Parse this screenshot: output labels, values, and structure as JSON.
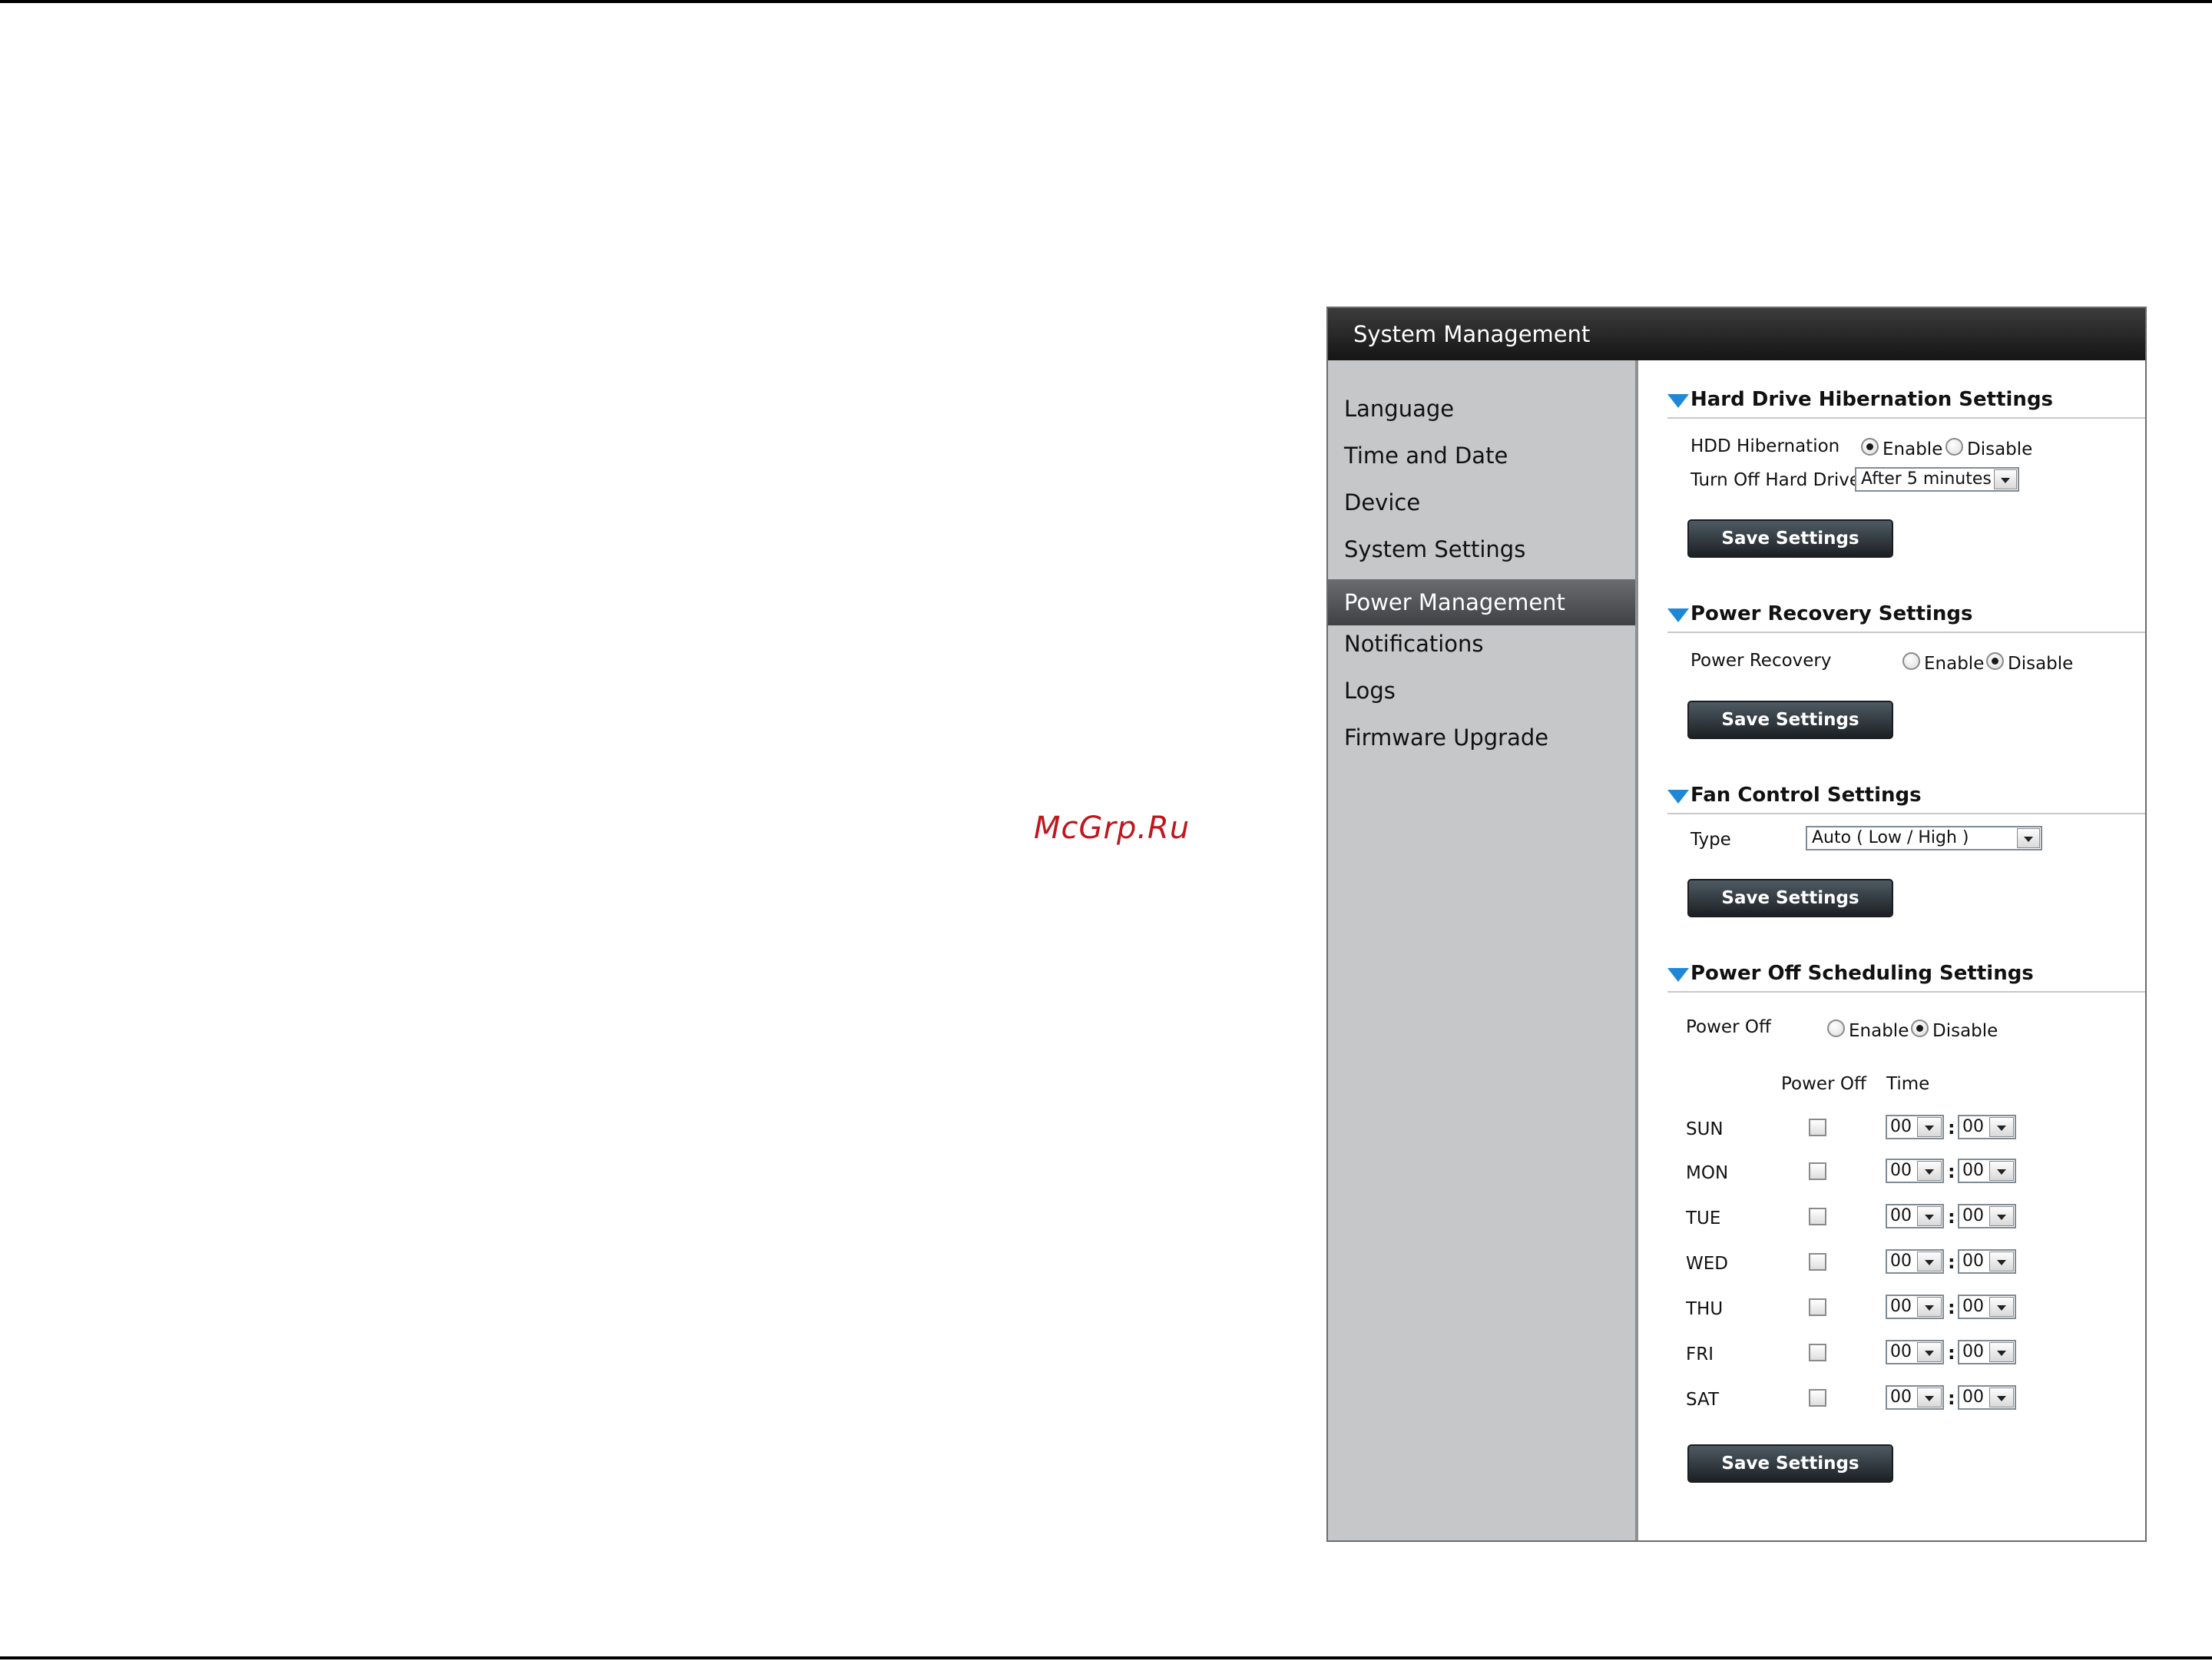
{
  "watermark": "McGrp.Ru",
  "window": {
    "title": "System Management"
  },
  "sidebar": {
    "items": [
      {
        "label": "Language"
      },
      {
        "label": "Time and Date"
      },
      {
        "label": "Device"
      },
      {
        "label": "System Settings"
      },
      {
        "label": "Power Management",
        "active": true
      },
      {
        "label": "Notifications"
      },
      {
        "label": "Logs"
      },
      {
        "label": "Firmware Upgrade"
      }
    ]
  },
  "colors": {
    "accent_triangle": "#1e88d7",
    "titlebar": "#1a1a1a",
    "sidebar": "#c6c7c9",
    "watermark": "#c0161e"
  },
  "hibernation": {
    "title": "Hard Drive Hibernation Settings",
    "hdd_label": "HDD Hibernation",
    "enable_label": "Enable",
    "disable_label": "Disable",
    "selected": "Enable",
    "turn_off_label": "Turn Off Hard Drives",
    "turn_off_value": "After 5 minutes",
    "save_label": "Save Settings"
  },
  "recovery": {
    "title": "Power Recovery Settings",
    "label": "Power Recovery",
    "enable_label": "Enable",
    "disable_label": "Disable",
    "selected": "Disable",
    "save_label": "Save Settings"
  },
  "fan": {
    "title": "Fan Control Settings",
    "type_label": "Type",
    "type_value": "Auto ( Low / High )",
    "save_label": "Save Settings"
  },
  "schedule": {
    "title": "Power Off Scheduling Settings",
    "label": "Power Off",
    "enable_label": "Enable",
    "disable_label": "Disable",
    "selected": "Disable",
    "col_power_off": "Power Off",
    "col_time": "Time",
    "colon": ":",
    "days": [
      {
        "day": "SUN",
        "checked": false,
        "hour": "00",
        "minute": "00"
      },
      {
        "day": "MON",
        "checked": false,
        "hour": "00",
        "minute": "00"
      },
      {
        "day": "TUE",
        "checked": false,
        "hour": "00",
        "minute": "00"
      },
      {
        "day": "WED",
        "checked": false,
        "hour": "00",
        "minute": "00"
      },
      {
        "day": "THU",
        "checked": false,
        "hour": "00",
        "minute": "00"
      },
      {
        "day": "FRI",
        "checked": false,
        "hour": "00",
        "minute": "00"
      },
      {
        "day": "SAT",
        "checked": false,
        "hour": "00",
        "minute": "00"
      }
    ],
    "save_label": "Save Settings"
  }
}
